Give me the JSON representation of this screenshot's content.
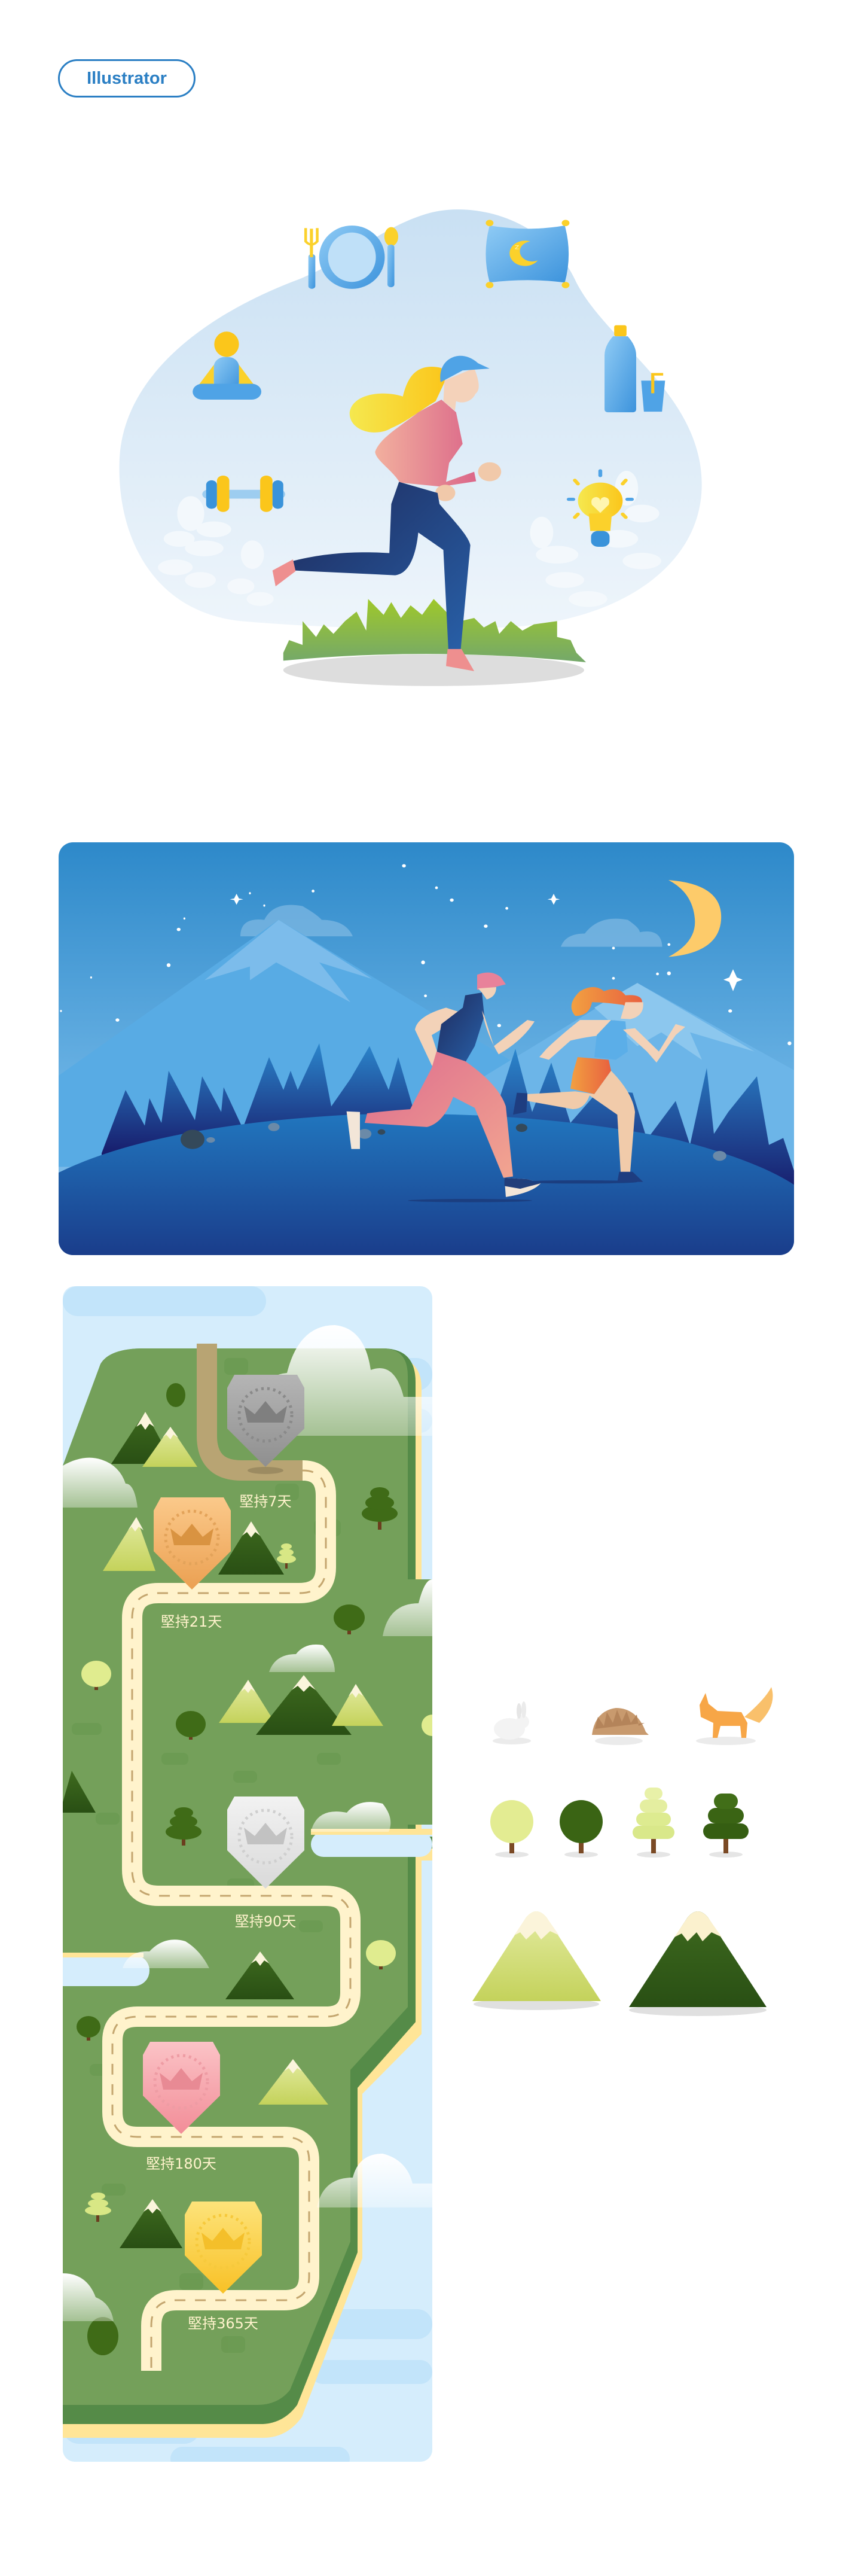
{
  "tag": {
    "label": "Illustrator",
    "color": "#2B7FC4"
  },
  "hero": {
    "icons": [
      "fork-plate-spoon-icon",
      "pillow-moon-icon",
      "meditation-icon",
      "water-bottle-icon",
      "dumbbell-icon",
      "lightbulb-heart-icon"
    ],
    "colors": {
      "blob": "#D3E7F6",
      "accent_blue": "#4FA3E6",
      "accent_yellow": "#FBD12B",
      "shirt": "#E07A8E",
      "pants": "#1F3A78"
    }
  },
  "night_scene": {
    "colors": {
      "sky": "#2C88C9",
      "ground": "#1B4C9A",
      "moon": "#FDCB6A"
    }
  },
  "map": {
    "milestones": [
      {
        "label": "堅持7天",
        "tier": "silver",
        "color": "#A8A8A8"
      },
      {
        "label": "堅持21天",
        "tier": "bronze",
        "color": "#F4B267"
      },
      {
        "label": "堅持90天",
        "tier": "white",
        "color": "#E6E6E6"
      },
      {
        "label": "堅持180天",
        "tier": "pink",
        "color": "#F6A9AE"
      },
      {
        "label": "堅持365天",
        "tier": "gold",
        "color": "#FBD54A"
      }
    ],
    "colors": {
      "land": "#74A05A",
      "road": "#FFF3CC",
      "water": "#D5EDFC",
      "shore": "#FFE597"
    }
  },
  "assets": {
    "animals": [
      "rabbit-icon",
      "hedgehog-icon",
      "fox-icon"
    ],
    "trees": [
      "light-round-tree-icon",
      "dark-round-tree-icon",
      "light-layered-tree-icon",
      "dark-pine-tree-icon"
    ],
    "mountains": [
      "light-mountain-icon",
      "dark-mountain-icon"
    ]
  }
}
